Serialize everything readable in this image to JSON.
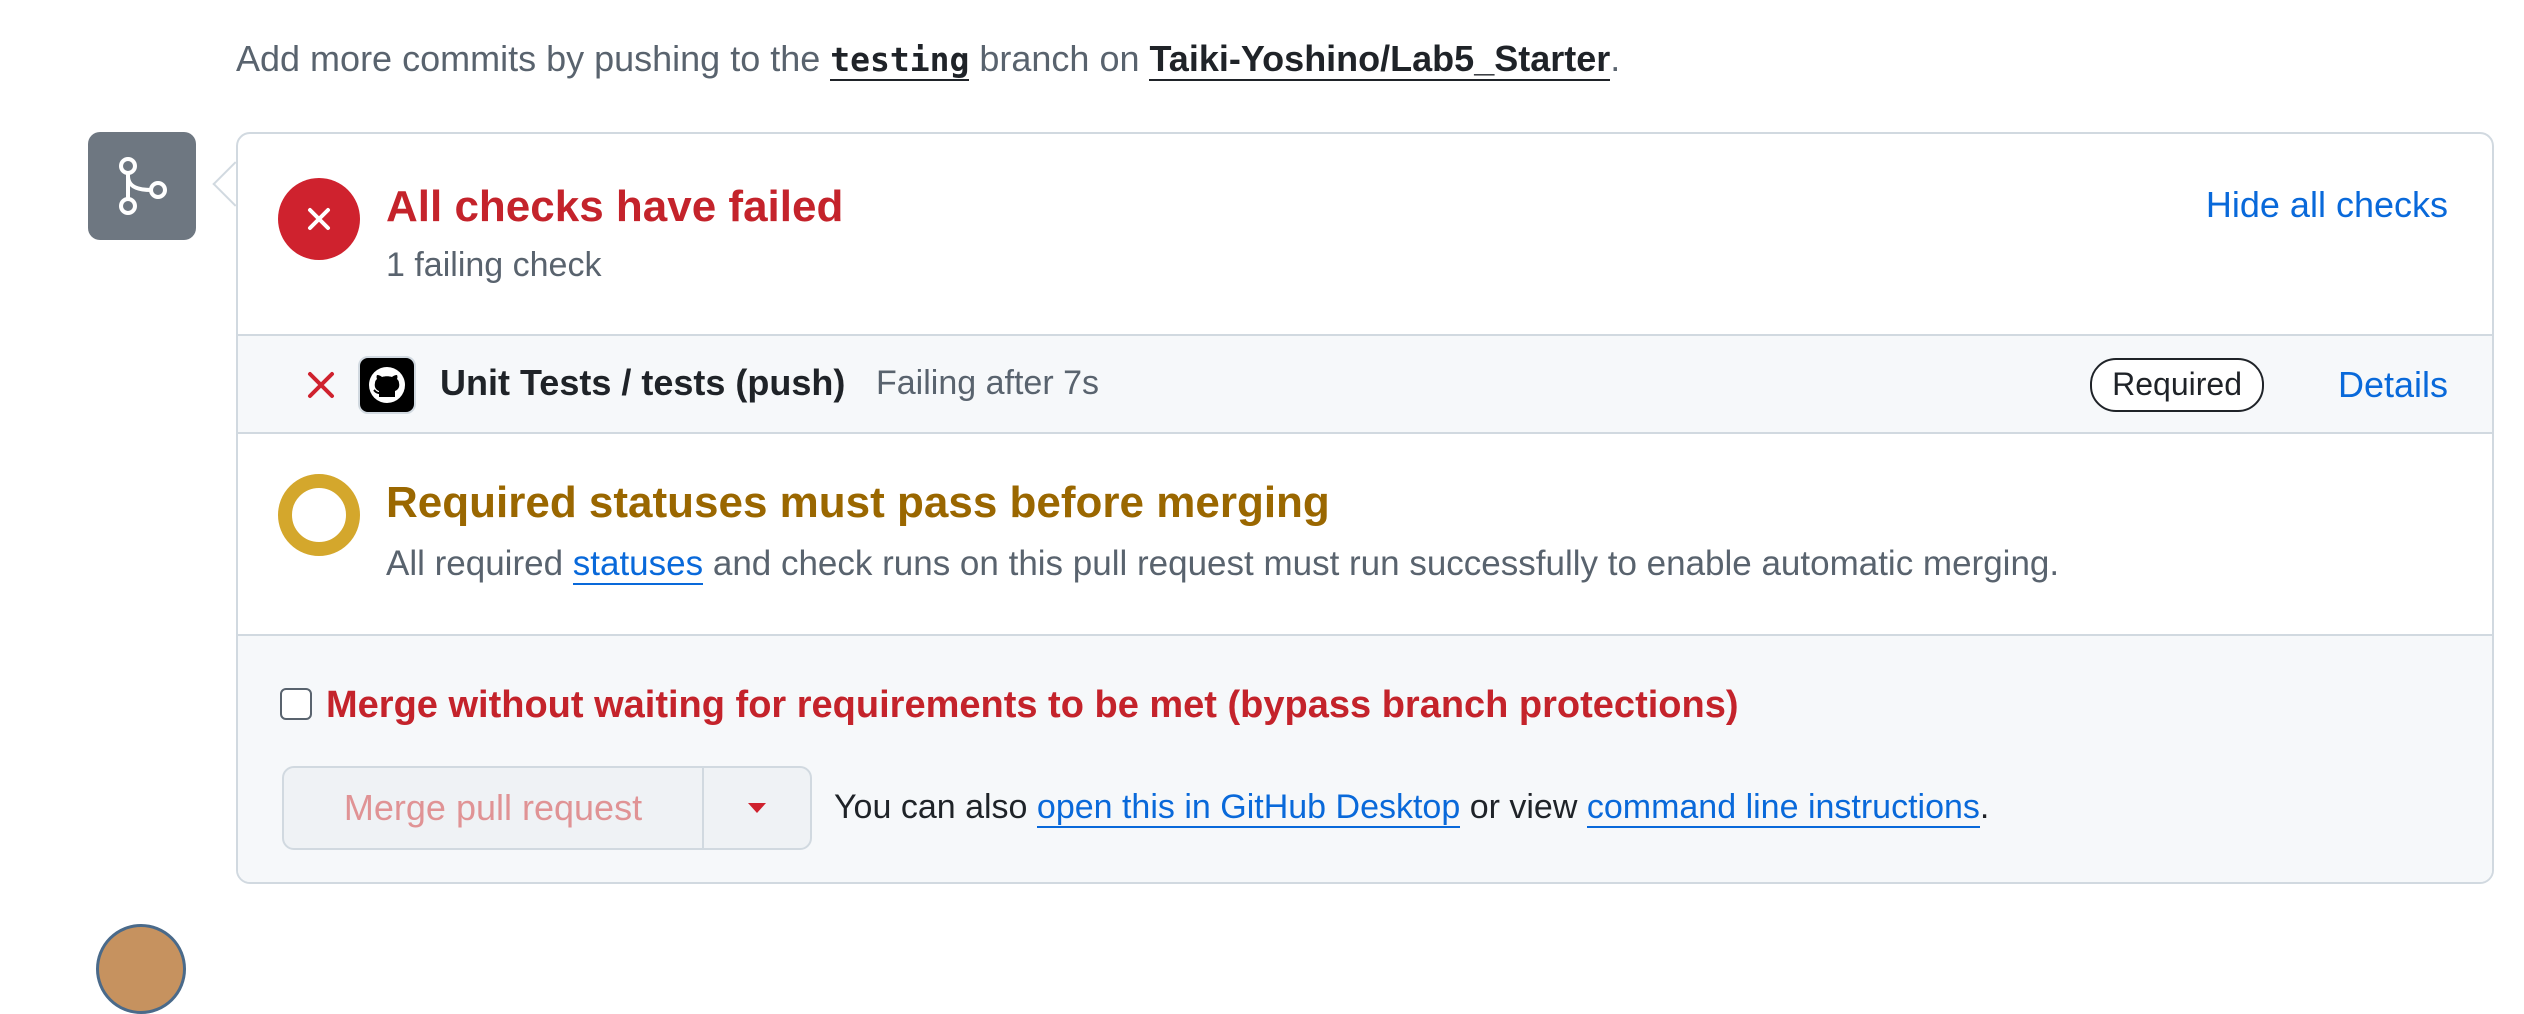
{
  "hint": {
    "prefix": "Add more commits by pushing to the ",
    "branch": "testing",
    "middle": " branch on ",
    "repo": "Taiki-Yoshino/Lab5_Starter",
    "suffix": "."
  },
  "summary": {
    "title": "All checks have failed",
    "subtitle": "1 failing check",
    "toggle_label": "Hide all checks"
  },
  "checks": [
    {
      "name": "Unit Tests / tests (push)",
      "status": "Failing after 7s",
      "badge": "Required",
      "details_label": "Details"
    }
  ],
  "requirement": {
    "title": "Required statuses must pass before merging",
    "desc_prefix": "All required ",
    "desc_link": "statuses",
    "desc_suffix": " and check runs on this pull request must run successfully to enable automatic merging."
  },
  "merge": {
    "bypass_label": "Merge without waiting for requirements to be met (bypass branch protections)",
    "bypass_checked": false,
    "button_label": "Merge pull request",
    "also_prefix": "You can also ",
    "desktop_link": "open this in GitHub Desktop",
    "also_middle": " or view ",
    "cli_link": "command line instructions",
    "also_suffix": "."
  },
  "colors": {
    "danger": "#cf222e",
    "attention": "#d4a72c",
    "accent": "#0969da"
  },
  "icons": {
    "branch": "git-branch-icon",
    "fail": "x-circle-fill-icon",
    "check_fail": "x-icon",
    "app": "github-mark-icon",
    "pending": "dot-ring-icon",
    "caret": "triangle-down-icon"
  }
}
